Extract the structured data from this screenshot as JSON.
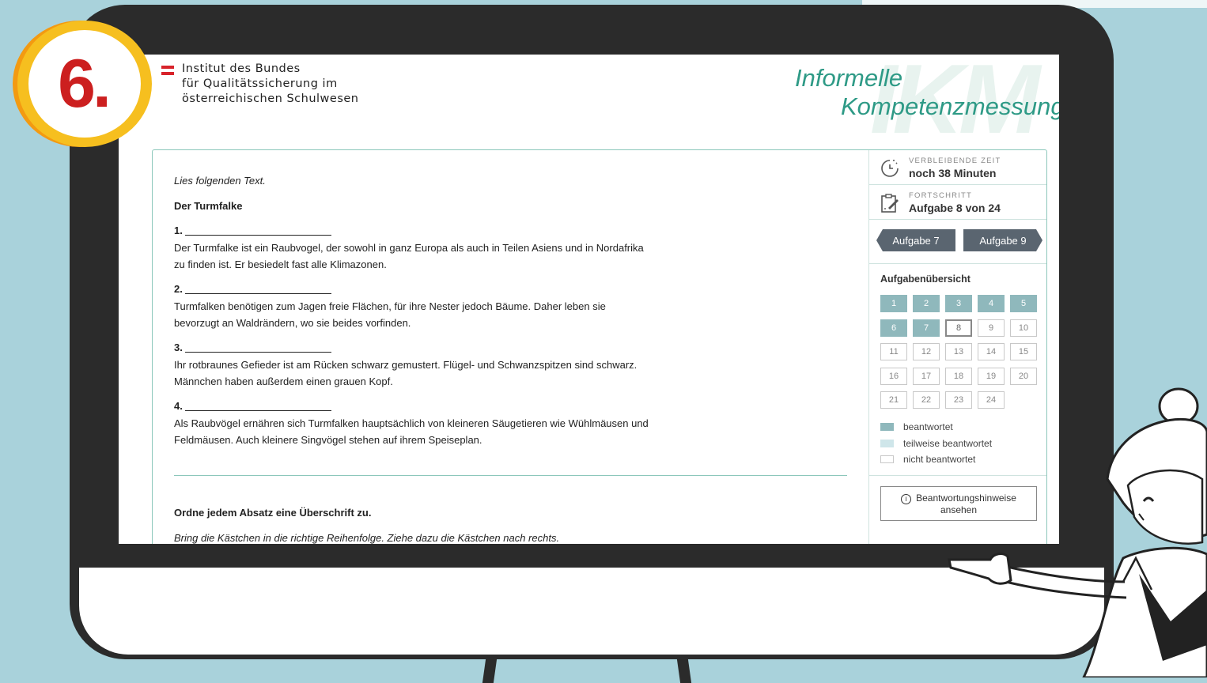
{
  "badge": {
    "step_number": "6."
  },
  "header": {
    "institute_lines": [
      "Institut des Bundes",
      "für Qualitätssicherung im",
      "österreichischen Schulwesen"
    ],
    "watermark": "IKM",
    "title_line1": "Informelle",
    "title_line2": "Kompetenzmessung"
  },
  "task": {
    "instruction": "Lies folgenden Text.",
    "text_title": "Der Turmfalke",
    "paragraphs": [
      {
        "number": "1.",
        "lines": [
          "Der Turmfalke ist ein Raubvogel, der sowohl in ganz Europa als auch in Teilen Asiens und in Nordafrika",
          "zu finden ist. Er besiedelt fast alle Klimazonen."
        ]
      },
      {
        "number": "2.",
        "lines": [
          "Turmfalken benötigen zum Jagen freie Flächen, für ihre Nester jedoch Bäume. Daher leben sie",
          "bevorzugt an Waldrändern, wo sie beides vorfinden."
        ]
      },
      {
        "number": "3.",
        "lines": [
          "Ihr rotbraunes Gefieder ist am Rücken schwarz gemustert. Flügel- und Schwanzspitzen sind schwarz.",
          "Männchen haben außerdem einen grauen Kopf."
        ]
      },
      {
        "number": "4.",
        "lines": [
          "Als Raubvögel ernähren sich Turmfalken hauptsächlich von kleineren Säugetieren wie Wühlmäusen und",
          "Feldmäusen. Auch kleinere Singvögel stehen auf ihrem Speiseplan."
        ]
      }
    ],
    "question": "Ordne jedem Absatz eine Überschrift zu.",
    "question_hint": "Bring die Kästchen in die richtige Reihenfolge. Ziehe dazu die Kästchen nach rechts."
  },
  "sidebar": {
    "time_label": "VERBLEIBENDE ZEIT",
    "time_value": "noch 38 Minuten",
    "progress_label": "FORTSCHRITT",
    "progress_value": "Aufgabe 8 von 24",
    "prev_button": "Aufgabe 7",
    "next_button": "Aufgabe 9",
    "overview_title": "Aufgabenübersicht",
    "tasks": [
      {
        "n": "1",
        "state": "answered"
      },
      {
        "n": "2",
        "state": "answered"
      },
      {
        "n": "3",
        "state": "answered"
      },
      {
        "n": "4",
        "state": "answered"
      },
      {
        "n": "5",
        "state": "answered"
      },
      {
        "n": "6",
        "state": "answered"
      },
      {
        "n": "7",
        "state": "answered"
      },
      {
        "n": "8",
        "state": "current"
      },
      {
        "n": "9",
        "state": "none"
      },
      {
        "n": "10",
        "state": "none"
      },
      {
        "n": "11",
        "state": "none"
      },
      {
        "n": "12",
        "state": "none"
      },
      {
        "n": "13",
        "state": "none"
      },
      {
        "n": "14",
        "state": "none"
      },
      {
        "n": "15",
        "state": "none"
      },
      {
        "n": "16",
        "state": "none"
      },
      {
        "n": "17",
        "state": "none"
      },
      {
        "n": "18",
        "state": "none"
      },
      {
        "n": "19",
        "state": "none"
      },
      {
        "n": "20",
        "state": "none"
      },
      {
        "n": "21",
        "state": "none"
      },
      {
        "n": "22",
        "state": "none"
      },
      {
        "n": "23",
        "state": "none"
      },
      {
        "n": "24",
        "state": "none"
      }
    ],
    "legend": [
      {
        "label": "beantwortet",
        "color": "#8fb8bc"
      },
      {
        "label": "teilweise beantwortet",
        "color": "#cfe6ea"
      },
      {
        "label": "nicht beantwortet",
        "color": "#ffffff"
      }
    ],
    "hint_button_line1": "Beantwortungshinweise",
    "hint_button_line2": "ansehen"
  },
  "colors": {
    "accent": "#2e9a86",
    "answered": "#8fb8bc",
    "nav": "#5a6570",
    "badge_red": "#cc1f1f",
    "badge_yellow": "#f6bf1f"
  }
}
